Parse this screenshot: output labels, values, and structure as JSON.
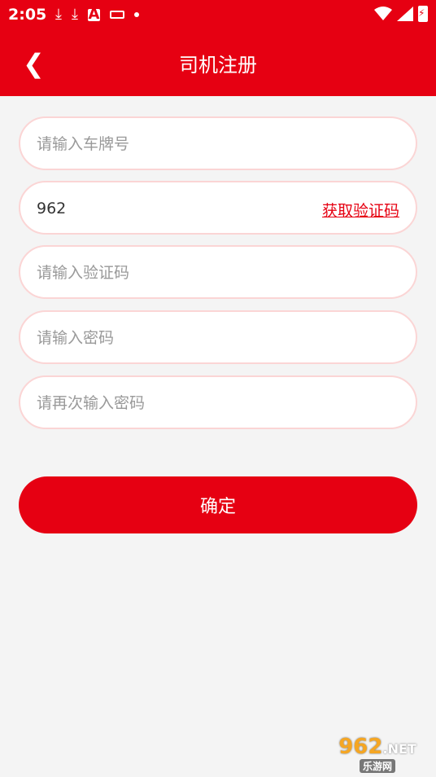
{
  "status_bar": {
    "time": "2:05",
    "icons": [
      "download-icon",
      "download-icon",
      "a-box-icon",
      "keyboard-icon",
      "dot-icon",
      "wifi-icon",
      "signal-icon",
      "battery-charging-icon"
    ],
    "a_label": "A"
  },
  "header": {
    "back_glyph": "❮",
    "title": "司机注册"
  },
  "form": {
    "plate": {
      "value": "",
      "placeholder": "请输入车牌号"
    },
    "phone": {
      "value": "962",
      "placeholder": ""
    },
    "get_code_label": "获取验证码",
    "code": {
      "value": "",
      "placeholder": "请输入验证码"
    },
    "password": {
      "value": "",
      "placeholder": "请输入密码"
    },
    "password_again": {
      "value": "",
      "placeholder": "请再次输入密码"
    }
  },
  "confirm_label": "确定",
  "watermark": {
    "top": "962",
    "top_suffix": ".NET",
    "bottom": "乐游网"
  },
  "colors": {
    "accent": "#e60012",
    "background": "#f4f4f4",
    "field_border": "#fbd5d5"
  }
}
